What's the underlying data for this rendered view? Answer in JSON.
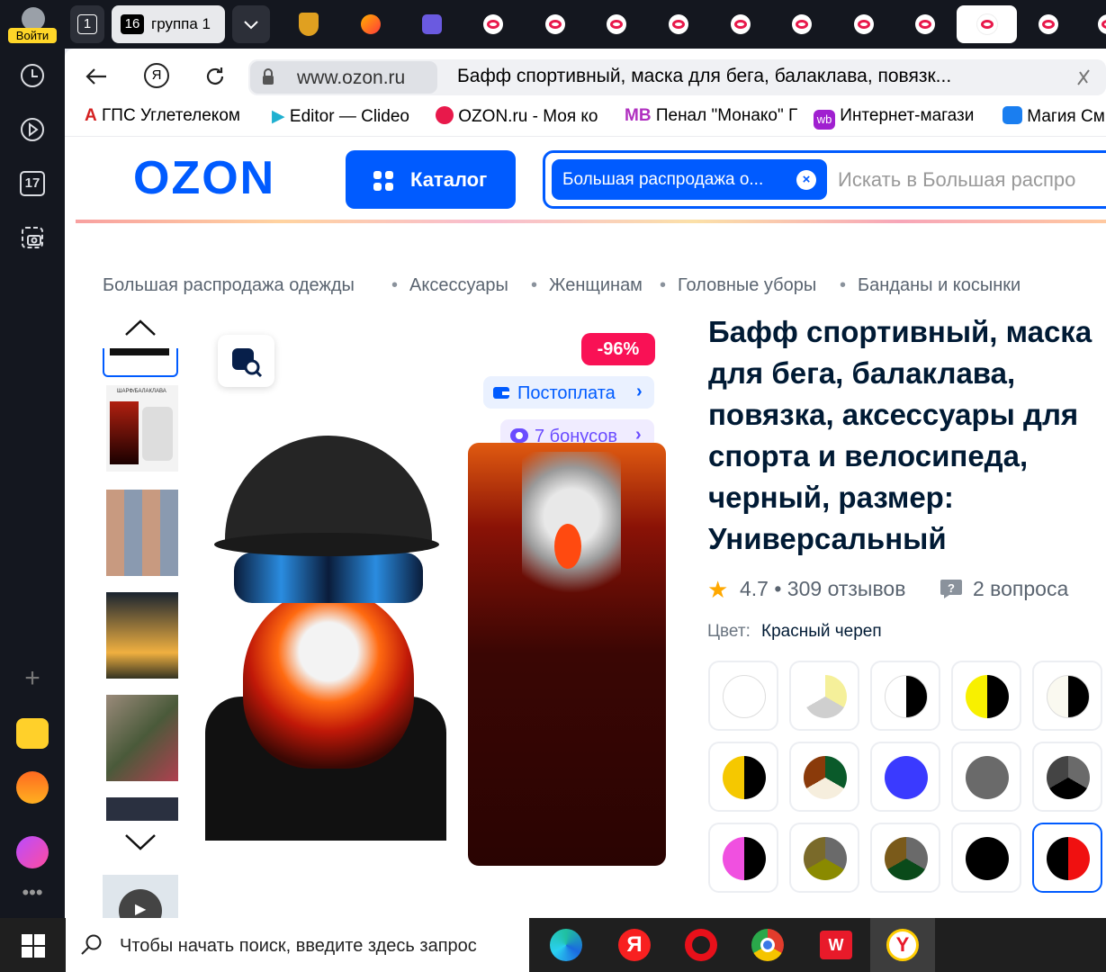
{
  "sidebar": {
    "login_label": "Войти",
    "calendar_day": "17"
  },
  "tabs": {
    "first_count": "1",
    "group_count": "16",
    "group_label": "группа 1"
  },
  "browser": {
    "url": "www.ozon.ru",
    "page_title": "Бафф спортивный, маска для бега, балаклава, повязк...",
    "bookmarks": [
      "ГПС Углетелеком",
      "Editor — Clideo",
      "OZON.ru - Моя ко",
      "Пенал \"Монако\" Г",
      "Интернет-магази",
      "Магия См"
    ]
  },
  "header": {
    "logo": "OZON",
    "catalog_label": "Каталог",
    "search_chip": "Большая распродажа о...",
    "search_placeholder": "Искать в Большая распро"
  },
  "breadcrumbs": [
    "Большая распродажа одежды",
    "Аксессуары",
    "Женщинам",
    "Головные уборы",
    "Банданы и косынки"
  ],
  "product": {
    "title": "Бафф спортивный, маска для бега, балаклава, повязка, аксессуары для спорта и велосипеда, черный, размер: Универсальный",
    "discount": "-96%",
    "postpay": "Постоплата",
    "bonus": "7 бонусов",
    "rating": "4.7 • 309 отзывов",
    "questions": "2 вопроса",
    "color_label": "Цвет:",
    "color_value": "Красный череп",
    "thumb_caption": "ШАРФ/БАЛАКЛАВА"
  },
  "taskbar": {
    "search_placeholder": "Чтобы начать поиск, введите здесь запрос"
  }
}
